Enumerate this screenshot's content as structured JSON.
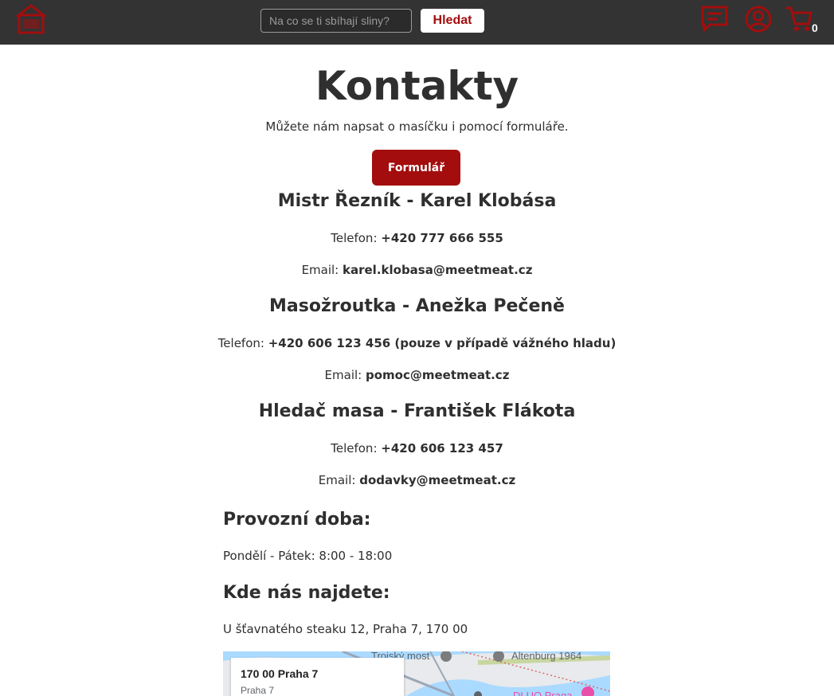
{
  "header": {
    "search_placeholder": "Na co se ti sbíhají sliny?",
    "search_button": "Hledat",
    "cart_count": "0",
    "accent_color": "#a30d0d",
    "icons": [
      "logo-house-icon",
      "chat-icon",
      "user-icon",
      "cart-icon"
    ]
  },
  "main": {
    "title": "Kontakty",
    "intro": "Můžete nám napsat o masíčku i pomocí formuláře.",
    "form_button": "Formulář"
  },
  "contacts": [
    {
      "name": "Mistr Řezník - Karel Klobása",
      "phone_label": "Telefon:",
      "phone": "+420 777 666 555",
      "email_label": "Email:",
      "email": "karel.klobasa@meetmeat.cz"
    },
    {
      "name": "Masožroutka - Anežka Pečeně",
      "phone_label": "Telefon:",
      "phone": "+420 606 123 456 (pouze v případě vážného hladu)",
      "email_label": "Email:",
      "email": "pomoc@meetmeat.cz"
    },
    {
      "name": "Hledač masa - František Flákota",
      "phone_label": "Telefon:",
      "phone": "+420 606 123 457",
      "email_label": "Email:",
      "email": "dodavky@meetmeat.cz"
    }
  ],
  "hours": {
    "heading": "Provozní doba:",
    "text": "Pondělí - Pátek: 8:00 - 18:00"
  },
  "location": {
    "heading": "Kde nás najdete:",
    "address": "U šťavnatého steaku 12, Praha 7, 170 00"
  },
  "map": {
    "card_title": "170 00 Praha 7",
    "card_subtitle": "Praha 7",
    "labels": [
      "Troiský most",
      "Altenburg 1964",
      "DLUQ Praga"
    ]
  }
}
